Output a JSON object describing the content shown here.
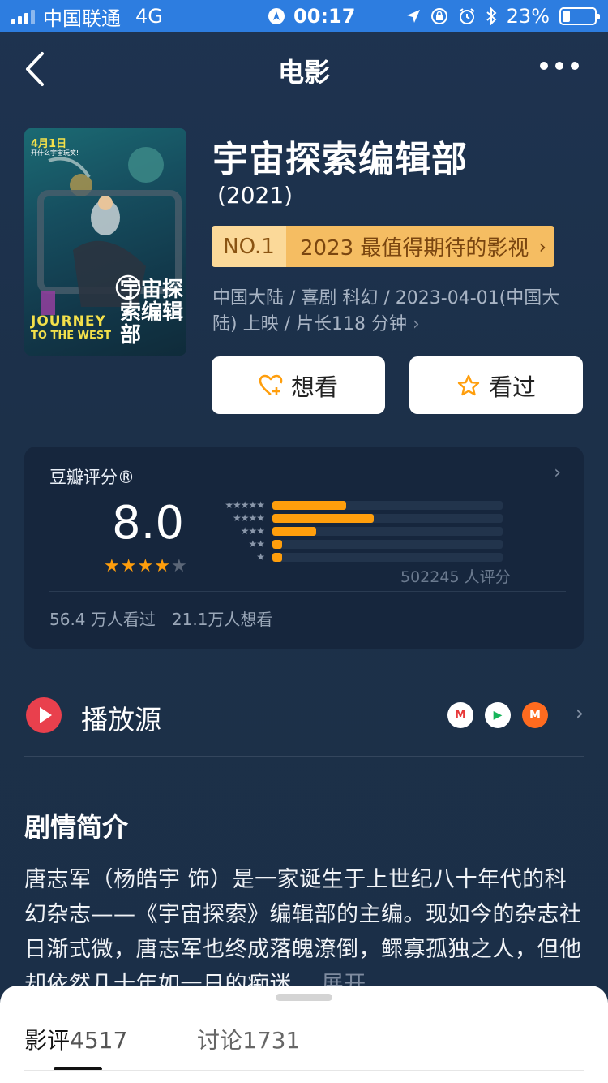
{
  "status_bar": {
    "carrier": "中国联通",
    "network": "4G",
    "time": "00:17",
    "battery": "23%",
    "battery_level": 0.23
  },
  "nav": {
    "title": "电影"
  },
  "poster": {
    "date": "4月1日",
    "tagline": "开什么宇宙玩笑!",
    "en_line1": "JOURNEY",
    "en_line2": "TO THE WEST",
    "cn_title": "宇宙探索编辑部"
  },
  "movie": {
    "title": "宇宙探索编辑部",
    "year": "(2021)",
    "rank_no": "NO.1",
    "rank_text": "2023 最值得期待的影视",
    "meta": "中国大陆 / 喜剧 科幻 / 2023-04-01(中国大陆) 上映 / 片长118 分钟"
  },
  "actions": {
    "want_label": "想看",
    "seen_label": "看过"
  },
  "rating": {
    "label": "豆瓣评分®",
    "score": "8.0",
    "stars": 4,
    "count": "502245 人评分",
    "distribution": [
      {
        "stars": 5,
        "fraction": 0.32
      },
      {
        "stars": 4,
        "fraction": 0.44
      },
      {
        "stars": 3,
        "fraction": 0.19
      },
      {
        "stars": 2,
        "fraction": 0.04
      },
      {
        "stars": 1,
        "fraction": 0.04
      }
    ],
    "seen_count": "56.4 万人看过",
    "want_count": "21.1万人想看",
    "accent": "#ff9e0c"
  },
  "play_source": {
    "label": "播放源",
    "platforms": [
      "M",
      "▶",
      "M"
    ]
  },
  "synopsis": {
    "title": "剧情简介",
    "text": "唐志军（杨皓宇 饰）是一家诞生于上世纪八十年代的科幻杂志——《宇宙探索》编辑部的主编。现如今的杂志社日渐式微，唐志军也终成落魄潦倒，鳏寡孤独之人，但他却依然几十年如一日的痴迷",
    "more": "展开"
  },
  "bottom_tabs": {
    "reviews_label": "影评",
    "reviews_count": "4517",
    "discussion_label": "讨论",
    "discussion_count": "1731"
  }
}
